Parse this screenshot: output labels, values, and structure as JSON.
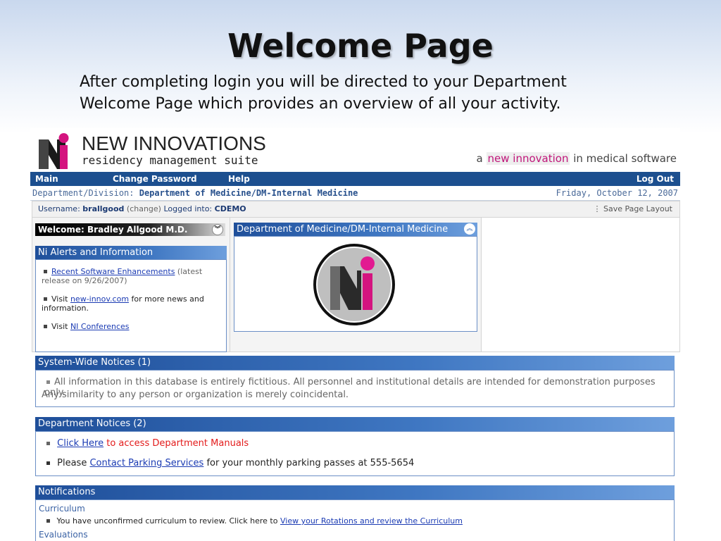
{
  "slide": {
    "title": "Welcome Page",
    "text_line1": "After completing login you will be directed to your Department",
    "text_line2": "Welcome Page which provides an overview of all your activity."
  },
  "brand": {
    "name": "NEW INNOVATIONS",
    "subtitle": "residency management suite",
    "tagline_pre": "a",
    "tagline_hl": "new innovation",
    "tagline_post": "in medical software"
  },
  "nav": {
    "main": "Main",
    "change_password": "Change Password",
    "help": "Help",
    "logout": "Log Out"
  },
  "dept_bar": {
    "label": "Department/Division:",
    "value": "Department of Medicine/DM-Internal Medicine",
    "date": "Friday, October 12, 2007"
  },
  "user_bar": {
    "username_label": "Username:",
    "username": "brallgood",
    "change": "(change)",
    "logged_label": "Logged into:",
    "logged_value": "CDEMO",
    "save_layout": "Save Page Layout"
  },
  "welcome": {
    "title": "Welcome: Bradley Allgood M.D."
  },
  "alerts": {
    "title": "Ni Alerts and Information",
    "item1_link": "Recent Software Enhancements",
    "item1_note_a": "(latest",
    "item1_note_b": "release on 9/26/2007)",
    "item2_pre": "Visit",
    "item2_link": "new-innov.com",
    "item2_post_a": "for more news and",
    "item2_post_b": "information.",
    "item3_pre": "Visit",
    "item3_link": "NI Conferences"
  },
  "dept_panel": {
    "title": "Department of Medicine/DM-Internal Medicine"
  },
  "system_notices": {
    "title": "System-Wide Notices (1)",
    "line1": "All information in this database is entirely fictitious. All personnel and institutional details are intended for demonstration purposes only.",
    "line2": "Any similarity to any person or organization is merely coincidental."
  },
  "dept_notices": {
    "title": "Department Notices (2)",
    "n1_link": "Click Here",
    "n1_text": "to access Department Manuals",
    "n2_pre": "Please",
    "n2_link": "Contact Parking Services",
    "n2_post": "for your monthly parking passes at 555-5654"
  },
  "notifications": {
    "title": "Notifications",
    "curriculum_label": "Curriculum",
    "curriculum_text": "You have unconfirmed curriculum to review. Click here to",
    "curriculum_link": "View your Rotations and review the Curriculum",
    "evaluations_label": "Evaluations"
  },
  "colors": {
    "nav_bg": "#1c4f8f",
    "panel_header": "#2b5fab",
    "link": "#1b3bb3",
    "accent_magenta": "#c0167a",
    "notice_red": "#e31b1b"
  }
}
